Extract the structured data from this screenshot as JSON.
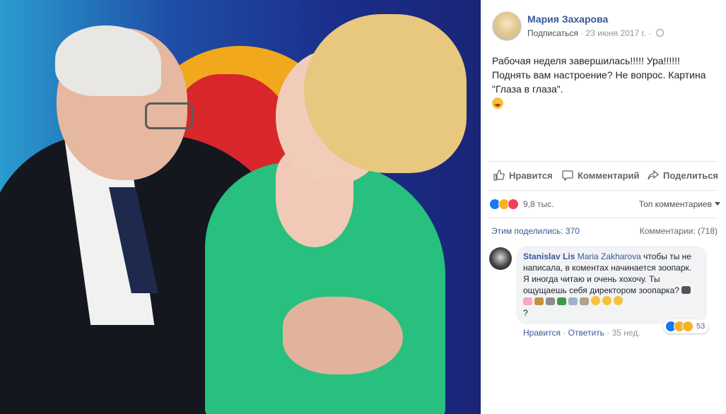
{
  "photo": {
    "subject": "photo"
  },
  "post": {
    "author": "Мария Захарова",
    "subscribe": "Подписаться",
    "dot": "·",
    "date": "23 июня 2017 г.",
    "dot2": "·",
    "text": "Рабочая неделя завершилась!!!!! Ура!!!!!! Поднять вам настроение? Не вопрос. Картина \"Глаза в глаза\"."
  },
  "actions": {
    "like": "Нравится",
    "comment": "Комментарий",
    "share": "Поделиться"
  },
  "reactions": {
    "count": "9,8 тыс.",
    "top_comments": "Топ комментариев"
  },
  "stats": {
    "shares": "Этим поделились: 370",
    "comments": "Комментарии: (718)"
  },
  "comment": {
    "author": "Stanislav Lis",
    "mention": "Maria Zakharova",
    "text": " чтобы ты не написала, в коментах начинается зоопарк. Я иногда читаю и очень хохочу. Ты ощущаешь себя директором зоопарка? ",
    "text_end": "?",
    "reaction_count": "53",
    "like": "Нравится",
    "sep": "·",
    "reply": "Ответить",
    "sep2": "·",
    "time": "35 нед."
  }
}
